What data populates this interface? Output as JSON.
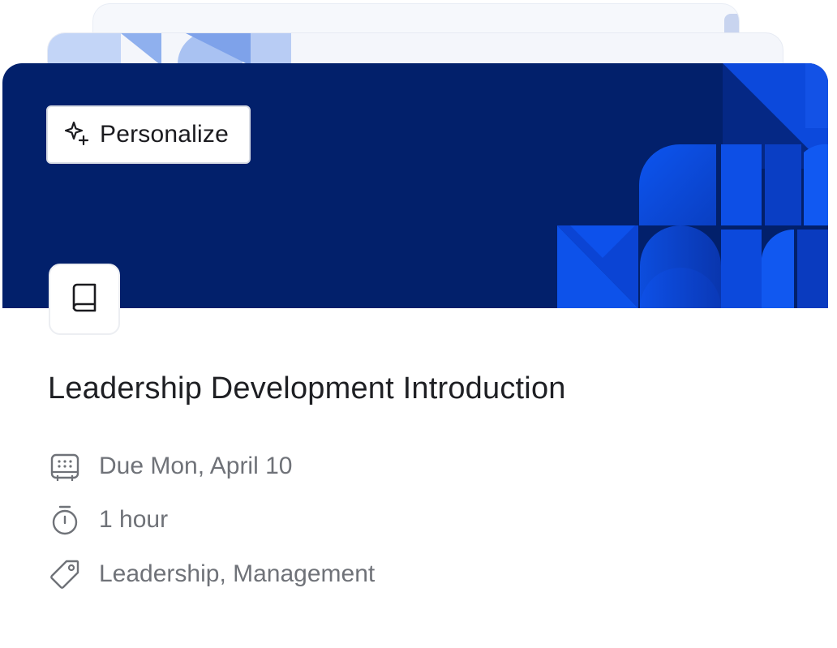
{
  "card": {
    "personalize_label": "Personalize",
    "title": "Leadership Development Introduction",
    "due": "Due Mon, April 10",
    "duration": "1 hour",
    "tags": "Leadership, Management"
  },
  "icons": {
    "personalize": "sparkle-icon",
    "course_type": "book-icon",
    "due": "calendar-icon",
    "duration": "stopwatch-icon",
    "tags": "tag-icon"
  },
  "colors": {
    "banner_background": "#02206b",
    "banner_pattern_primary": "#0b4fe0",
    "banner_pattern_secondary": "#1441c9",
    "title_text": "#1e1f23",
    "meta_text": "#6f7278"
  }
}
